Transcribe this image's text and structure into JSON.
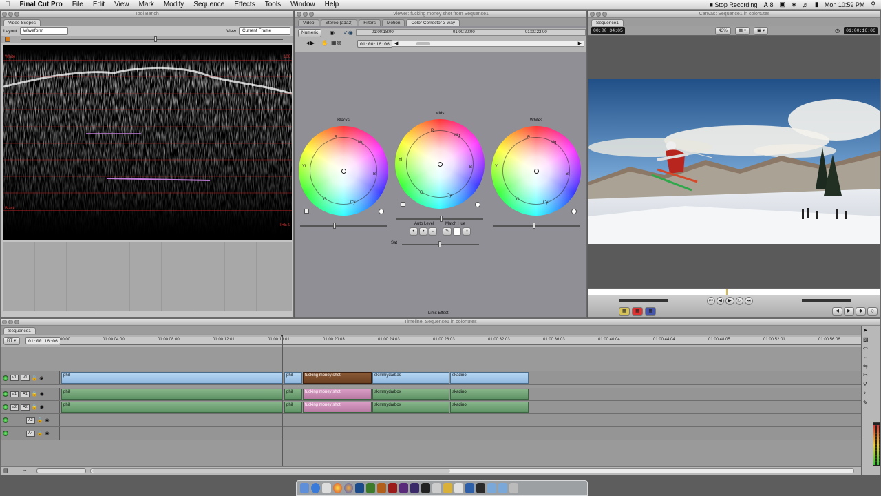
{
  "menubar": {
    "app_name": "Final Cut Pro",
    "items": [
      "File",
      "Edit",
      "View",
      "Mark",
      "Modify",
      "Sequence",
      "Effects",
      "Tools",
      "Window",
      "Help"
    ],
    "stop_recording": "Stop Recording",
    "input_badge": "A",
    "badge_num": "8",
    "clock": "Mon 10:59 PM"
  },
  "tool_bench": {
    "title": "Tool Bench",
    "tab": "Video Scopes",
    "layout_label": "Layout",
    "layout_value": "Waveform",
    "view_label": "View",
    "view_value": "Current Frame",
    "labels": {
      "white": "White",
      "black": "Black",
      "top_right": "100",
      "bottom_right": "IRE 0"
    }
  },
  "viewer": {
    "title": "Viewer: fucking money shot from Sequence1",
    "tabs": [
      "Video",
      "Stereo (a1a2)",
      "Filters",
      "Motion",
      "Color Corrector 3-way"
    ],
    "numeric_button": "Numeric",
    "timecode": "01:00:16:06",
    "ruler": [
      "01:00:18:00",
      "01:00:20:00",
      "01:00:22:00"
    ],
    "wheels": [
      {
        "label": "Blacks"
      },
      {
        "label": "Mids"
      },
      {
        "label": "Whites"
      }
    ],
    "wheel_hue_letters": {
      "R": "R",
      "Mg": "Mg",
      "B": "B",
      "Cy": "Cy",
      "G": "G",
      "Yl": "Yl"
    },
    "auto_level": "Auto Level",
    "match_hue": "Match Hue",
    "sat_label": "Sat",
    "limit_effect": "Limit Effect"
  },
  "canvas": {
    "title": "Canvas: Sequence1 in colortutes",
    "tab": "Sequence1",
    "timecode_left": "00:00:34:05",
    "zoom": "43%",
    "timecode_right": "01:00:16:06"
  },
  "timeline": {
    "title": "Timeline: Sequence1 in colortutes",
    "tab": "Sequence1",
    "rt_label": "RT",
    "timecode": "01:00:16:06",
    "ruler": [
      "00:00",
      "01:00:04:00",
      "01:00:08:00",
      "01:00:12:01",
      "01:00:16:01",
      "01:00:20:03",
      "01:00:24:03",
      "01:00:28:03",
      "01:00:32:03",
      "01:00:36:03",
      "01:00:40:04",
      "01:00:44:04",
      "01:00:48:05",
      "01:00:52:01",
      "01:00:56:06"
    ],
    "tracks": [
      {
        "patch": "v1",
        "label": "V1"
      },
      {
        "patch": "a1",
        "label": "A1"
      },
      {
        "patch": "a2",
        "label": "A2"
      },
      {
        "patch": "",
        "label": "A3"
      },
      {
        "patch": "",
        "label": "A4"
      }
    ],
    "video_clips": [
      "phil",
      "phil",
      "fucking money shot",
      "skimmydarbas",
      "skadino"
    ],
    "audio_clips_a1": [
      "phil",
      "phil",
      "fucking money shot",
      "skimmydarbox",
      "skadino"
    ],
    "audio_clips_a2": [
      "phil",
      "phil",
      "fucking money shot",
      "skimmydarbox",
      "skadino"
    ]
  },
  "colors": {
    "video_clip": "#a9cdee",
    "audio_clip": "#73a679",
    "selected_clip": "#c98cb4",
    "panel": "#c4c4c4"
  }
}
